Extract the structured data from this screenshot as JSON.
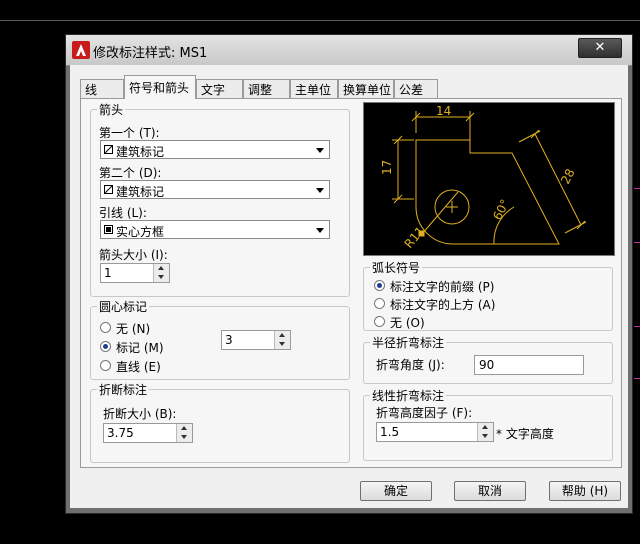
{
  "window": {
    "title": "修改标注样式: MS1",
    "close_label": "✕"
  },
  "tabs": [
    {
      "label": "线",
      "active": false
    },
    {
      "label": "符号和箭头",
      "active": true
    },
    {
      "label": "文字",
      "active": false
    },
    {
      "label": "调整",
      "active": false
    },
    {
      "label": "主单位",
      "active": false
    },
    {
      "label": "换算单位",
      "active": false
    },
    {
      "label": "公差",
      "active": false
    }
  ],
  "arrows": {
    "group_title": "箭头",
    "first_label": "第一个 (T):",
    "first_value": "建筑标记",
    "second_label": "第二个 (D):",
    "second_value": "建筑标记",
    "leader_label": "引线 (L):",
    "leader_value": "实心方框",
    "size_label": "箭头大小 (I):",
    "size_value": "1"
  },
  "center_mark": {
    "group_title": "圆心标记",
    "none_label": "无 (N)",
    "mark_label": "标记 (M)",
    "line_label": "直线 (E)",
    "selected": "mark",
    "size_value": "3"
  },
  "break": {
    "group_title": "折断标注",
    "size_label": "折断大小 (B):",
    "size_value": "3.75"
  },
  "preview": {
    "dim_top": "14",
    "dim_left": "17",
    "dim_right": "28",
    "dim_angle": "60°",
    "dim_radius": "R11",
    "line_color": "#e0b020"
  },
  "arc_length": {
    "group_title": "弧长符号",
    "option1": "标注文字的前缀 (P)",
    "option2": "标注文字的上方 (A)",
    "option3": "无 (O)",
    "selected": "option1"
  },
  "radius_jog": {
    "group_title": "半径折弯标注",
    "angle_label": "折弯角度 (J):",
    "angle_value": "90"
  },
  "linear_jog": {
    "group_title": "线性折弯标注",
    "factor_label": "折弯高度因子 (F):",
    "factor_value": "1.5",
    "suffix": "* 文字高度"
  },
  "buttons": {
    "ok": "确定",
    "cancel": "取消",
    "help": "帮助 (H)"
  },
  "colors": {
    "accent_radio": "#1e3f8f",
    "marker": "#c0308f"
  }
}
